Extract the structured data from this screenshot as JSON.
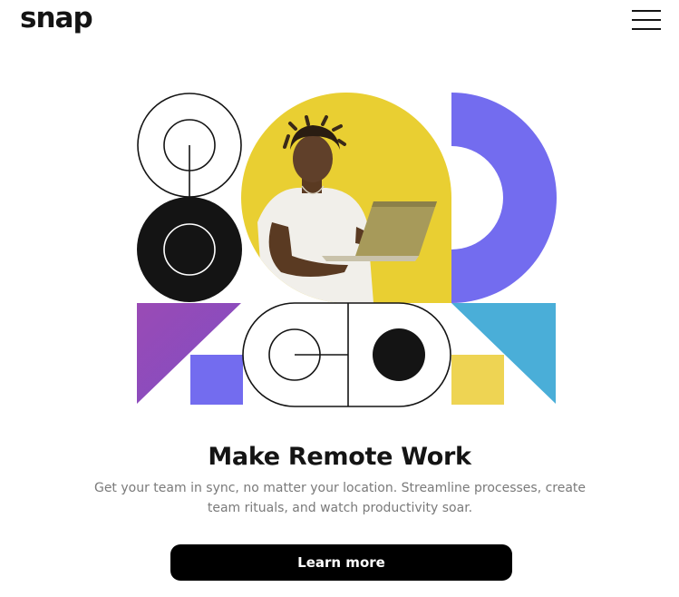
{
  "header": {
    "logo_text": "snap",
    "menu_icon": "hamburger-menu-icon"
  },
  "hero": {
    "image_subject": "person holding laptop",
    "colors": {
      "yellow": "#e9cf32",
      "purple_blue": "#736cef",
      "violet": "#8e4cb8",
      "sky_blue": "#4aaed8",
      "pale_yellow": "#eed453",
      "black": "#141414"
    }
  },
  "content": {
    "headline": "Make Remote Work",
    "description": "Get your team in sync, no matter your location. Streamline processes, create team rituals, and watch productivity soar.",
    "cta_label": "Learn more"
  }
}
